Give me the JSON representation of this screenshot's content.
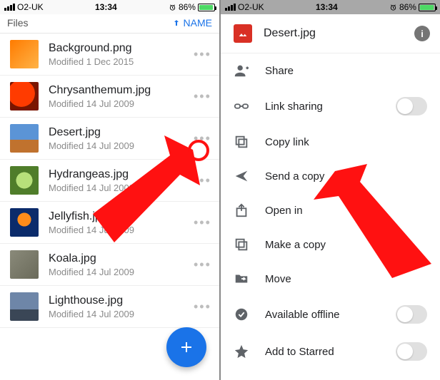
{
  "status": {
    "carrier": "O2-UK",
    "time": "13:34",
    "battery_pct": "86%"
  },
  "left": {
    "header_label": "Files",
    "sort_label": "NAME",
    "files": [
      {
        "name": "Background.png",
        "sub": "Modified 1 Dec 2015"
      },
      {
        "name": "Chrysanthemum.jpg",
        "sub": "Modified 14 Jul 2009"
      },
      {
        "name": "Desert.jpg",
        "sub": "Modified 14 Jul 2009"
      },
      {
        "name": "Hydrangeas.jpg",
        "sub": "Modified 14 Jul 2009"
      },
      {
        "name": "Jellyfish.jpg",
        "sub": "Modified 14 Jul 2009"
      },
      {
        "name": "Koala.jpg",
        "sub": "Modified 14 Jul 2009"
      },
      {
        "name": "Lighthouse.jpg",
        "sub": "Modified 14 Jul 2009"
      }
    ]
  },
  "right": {
    "title": "Desert.jpg",
    "menu": [
      {
        "label": "Share"
      },
      {
        "label": "Link sharing"
      },
      {
        "label": "Copy link"
      },
      {
        "label": "Send a copy"
      },
      {
        "label": "Open in"
      },
      {
        "label": "Make a copy"
      },
      {
        "label": "Move"
      },
      {
        "label": "Available offline"
      },
      {
        "label": "Add to Starred"
      }
    ]
  }
}
